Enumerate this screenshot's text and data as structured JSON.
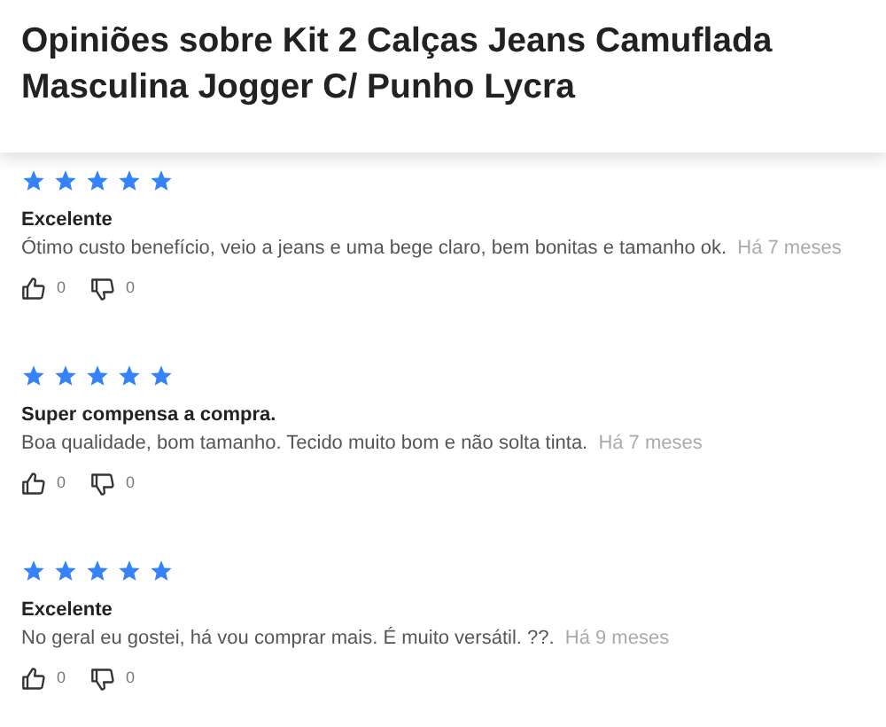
{
  "header": {
    "title": "Opiniões sobre Kit 2 Calças Jeans Camuflada Masculina Jogger C/ Punho Lycra"
  },
  "reviews": [
    {
      "stars": 5,
      "title": "Excelente",
      "text": "Ótimo custo benefício, veio a jeans e uma bege claro, bem bonitas e tamanho ok.",
      "date": "Há 7 meses",
      "likes": "0",
      "dislikes": "0"
    },
    {
      "stars": 5,
      "title": "Super compensa a compra.",
      "text": "Boa qualidade, bom tamanho. Tecido muito bom e não solta tinta.",
      "date": "Há 7 meses",
      "likes": "0",
      "dislikes": "0"
    },
    {
      "stars": 5,
      "title": "Excelente",
      "text": "No geral eu gostei, há vou comprar mais. É muito versátil. ??.",
      "date": "Há 9 meses",
      "likes": "0",
      "dislikes": "0"
    }
  ]
}
